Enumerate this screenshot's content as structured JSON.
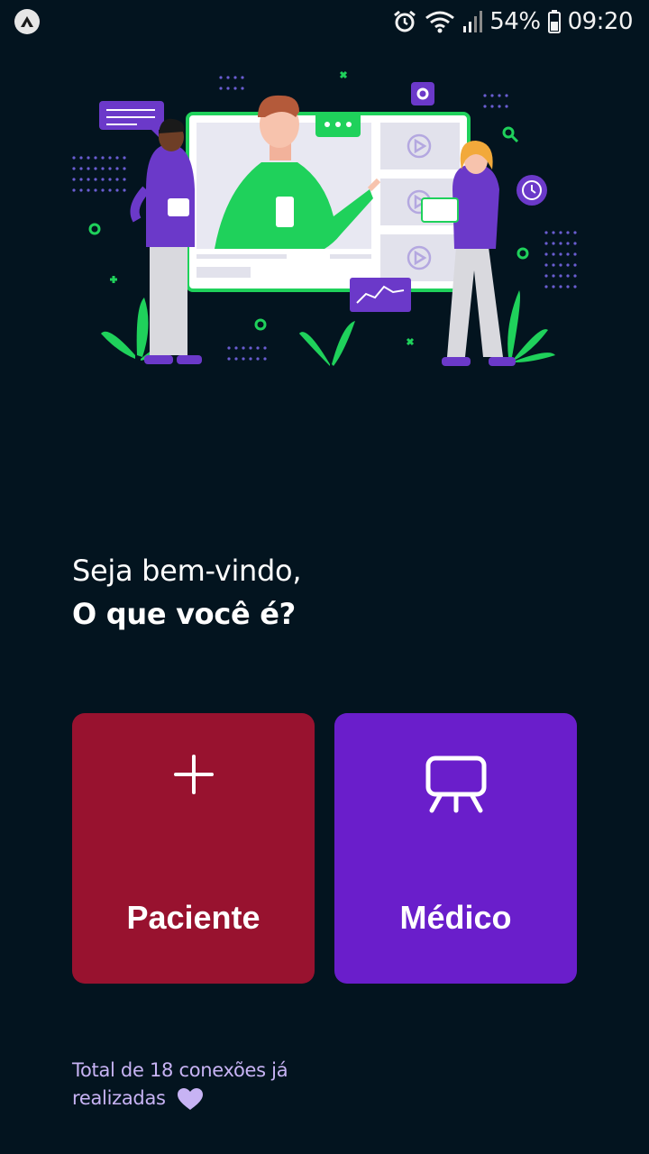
{
  "status_bar": {
    "battery": "54%",
    "time": "09:20",
    "icons": [
      "expo-icon",
      "alarm-icon",
      "wifi-icon",
      "signal-icon",
      "battery-icon"
    ]
  },
  "greeting": {
    "line1": "Seja bem-vindo,",
    "line2": "O que você é?"
  },
  "options": {
    "patient": {
      "label": "Paciente",
      "icon": "plus-icon",
      "color": "#98122f"
    },
    "doctor": {
      "label": "Médico",
      "icon": "presentation-screen-icon",
      "color": "#6a1ecb"
    }
  },
  "footer": {
    "line1": "Total de 18 conexões já",
    "line2": "realizadas",
    "icon": "heart-icon"
  },
  "colors": {
    "background": "#03141f",
    "accent_green": "#1fd15b",
    "accent_purple": "#6b39c9",
    "footer_text": "#c7b3f4"
  }
}
